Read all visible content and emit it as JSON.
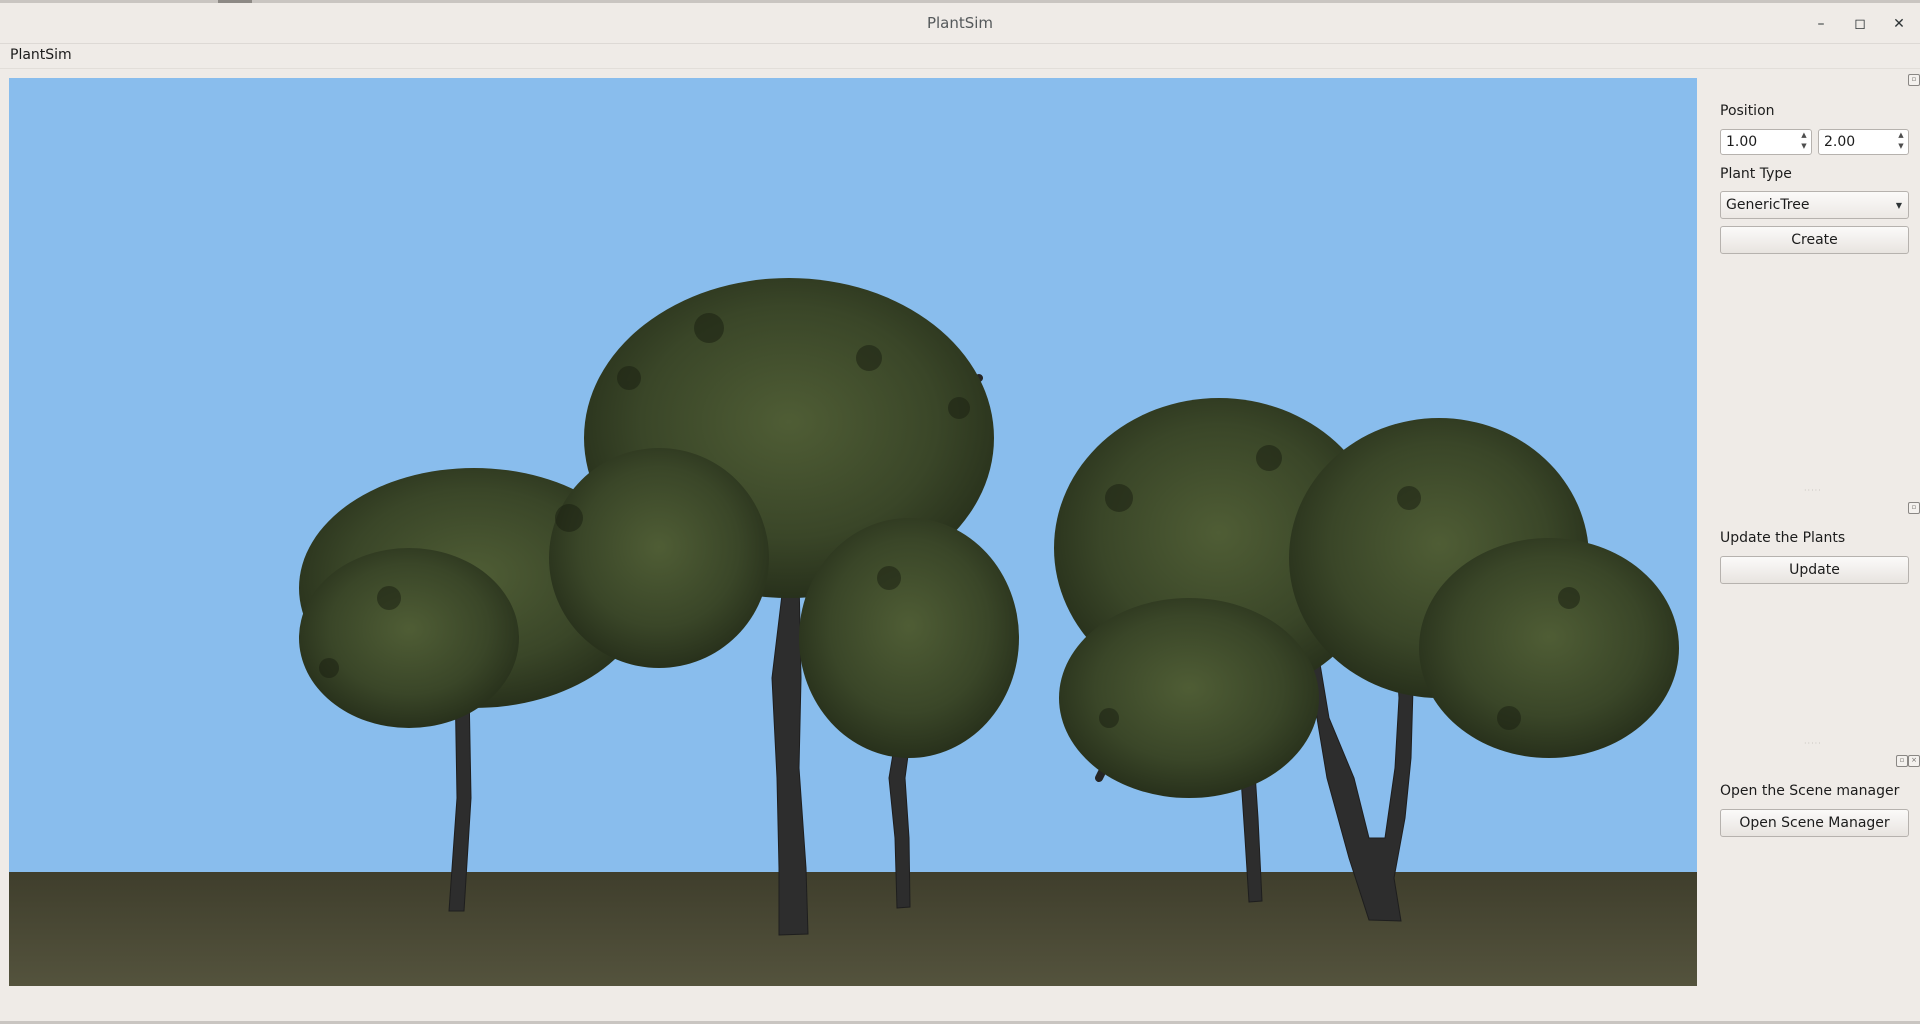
{
  "window": {
    "title": "PlantSim",
    "minimize_glyph": "–",
    "maximize_glyph": "◻",
    "close_glyph": "✕"
  },
  "menu": {
    "items": [
      "PlantSim"
    ]
  },
  "viewport": {
    "sky_color": "#89bded",
    "ground_color": "#4a4a32",
    "foliage_color": "#3c4a2a",
    "trunk_color": "#2e2e2e"
  },
  "panel": {
    "position": {
      "label": "Position",
      "x_value": "1.00",
      "y_value": "2.00"
    },
    "plant_type": {
      "label": "Plant Type",
      "selected": "GenericTree"
    },
    "create_button": "Create",
    "update": {
      "label": "Update the Plants",
      "button": "Update"
    },
    "scene_manager": {
      "label": "Open the Scene manager",
      "button": "Open Scene Manager"
    }
  }
}
